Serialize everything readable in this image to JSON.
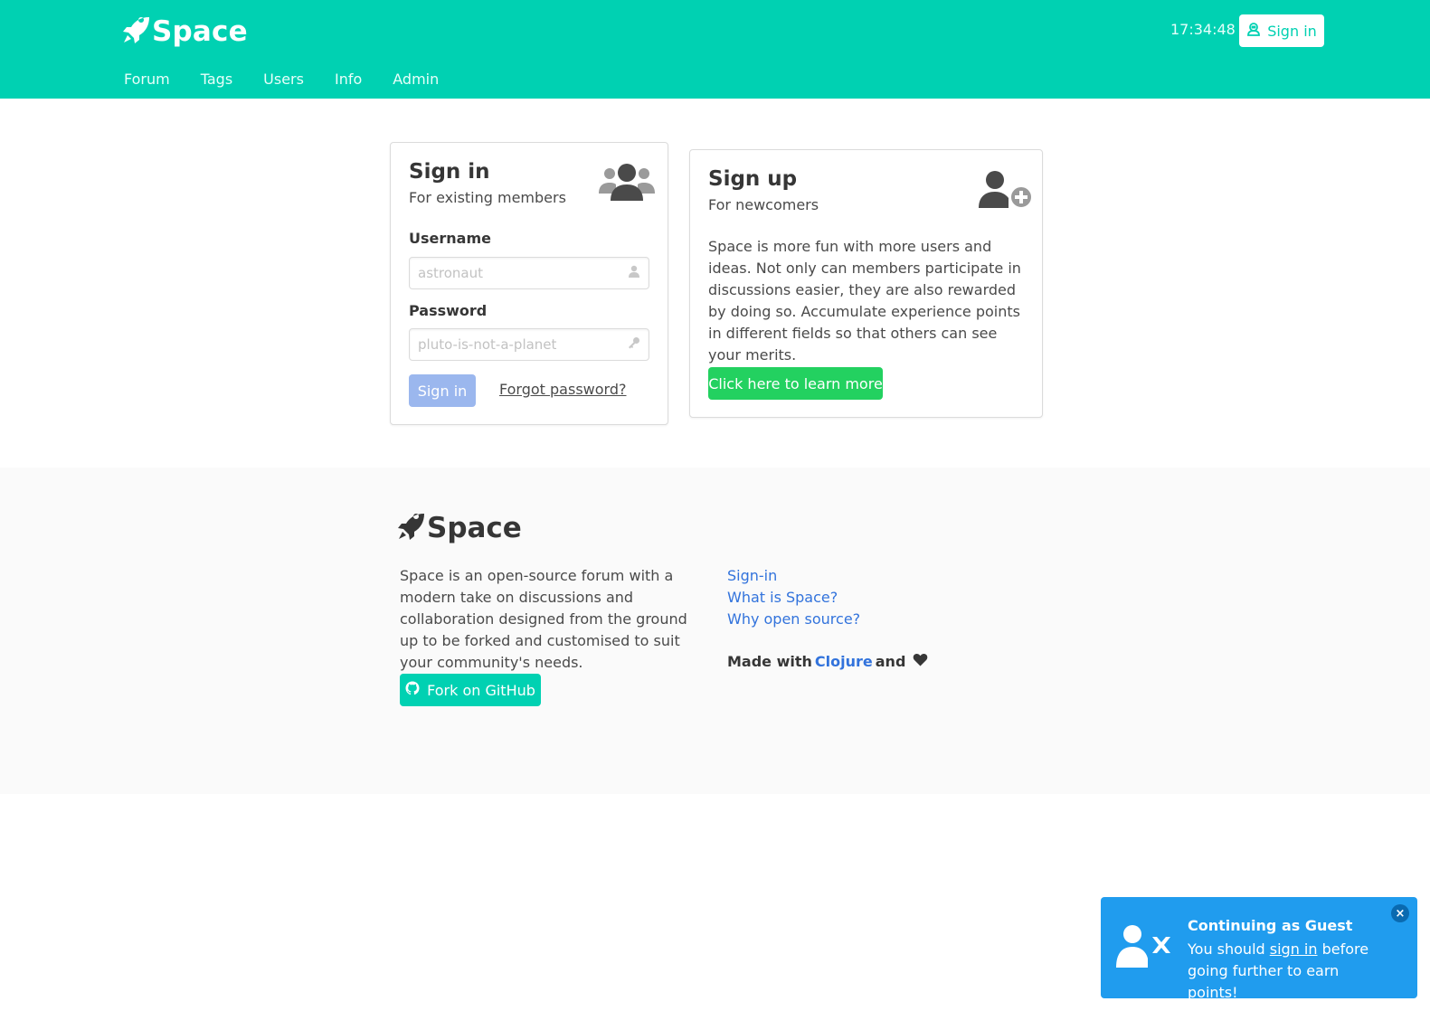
{
  "brand": {
    "name": "Space",
    "logo_icon": "rocket-icon"
  },
  "header": {
    "clock": "17:34:48",
    "signin_label": "Sign in",
    "signin_icon": "user-astronaut-icon",
    "nav": [
      "Forum",
      "Tags",
      "Users",
      "Info",
      "Admin"
    ]
  },
  "signin_card": {
    "title": "Sign in",
    "subtitle": "For existing members",
    "icon": "users-icon",
    "username_label": "Username",
    "username_placeholder": "astronaut",
    "username_icon": "user-icon",
    "password_label": "Password",
    "password_placeholder": "pluto-is-not-a-planet",
    "password_icon": "key-icon",
    "submit_label": "Sign in",
    "forgot_label": "Forgot password?"
  },
  "signup_card": {
    "title": "Sign up",
    "subtitle": "For newcomers",
    "icon": "user-plus-icon",
    "description": "Space is more fun with more users and ideas. Not only can members participate in discussions easier, they are also rewarded by doing so. Accumulate experience points in different fields so that others can see your merits.",
    "button_label": "Click here to learn more"
  },
  "footer": {
    "brand": "Space",
    "description": "Space is an open-source forum with a modern take on discussions and collaboration designed from the ground up to be forked and customised to suit your community's needs.",
    "github_label": "Fork on GitHub",
    "github_icon": "github-icon",
    "links": [
      "Sign-in",
      "What is Space?",
      "Why open source?"
    ],
    "made_with_prefix": "Made with",
    "made_with_link": "Clojure",
    "made_with_suffix": "and",
    "heart_icon": "heart-icon"
  },
  "toast": {
    "title": "Continuing as Guest",
    "text_before": "You should ",
    "link": "sign in",
    "text_after": " before going further to earn points!",
    "close": "×",
    "icon": "user-times-icon"
  },
  "colors": {
    "primary": "#00d1b2",
    "success": "#23d160",
    "info": "#209cee",
    "link": "#3273dc",
    "signin_disabled": "#9bb7ee"
  }
}
